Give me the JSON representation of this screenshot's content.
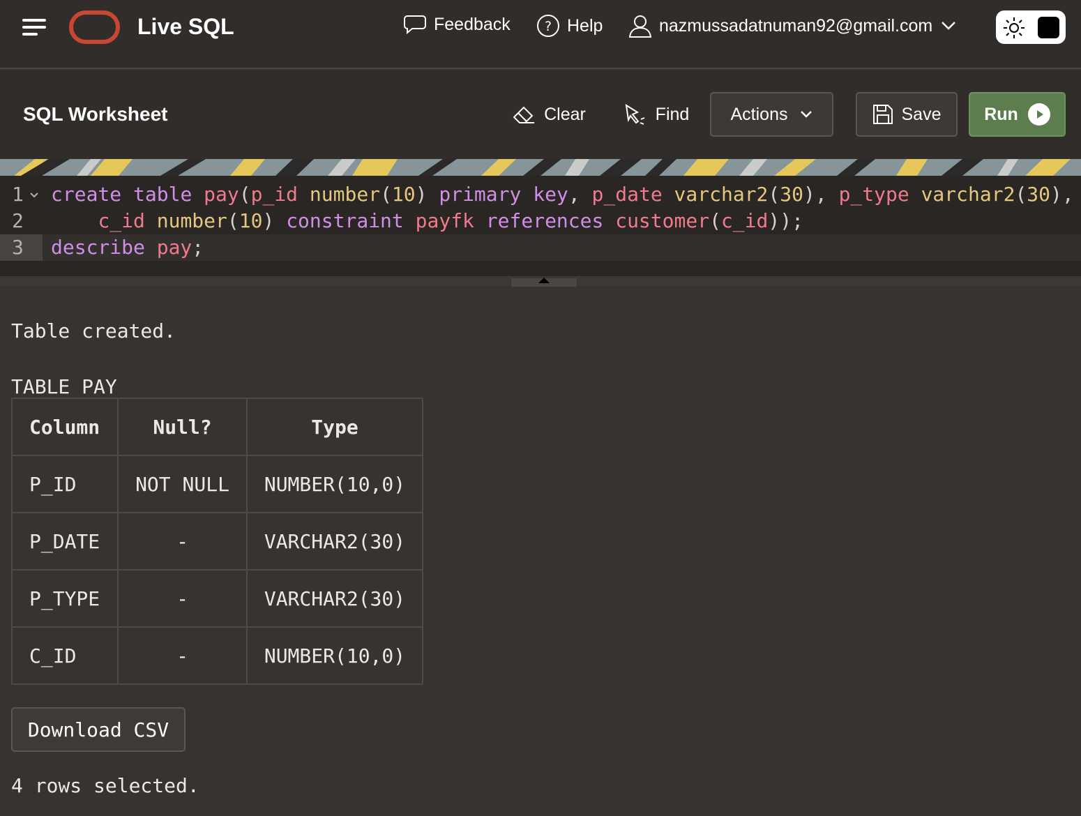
{
  "header": {
    "app_title": "Live SQL",
    "feedback_label": "Feedback",
    "help_label": "Help",
    "user_email": "nazmussadatnuman92@gmail.com",
    "brand_color": "#c74634"
  },
  "toolbar": {
    "title": "SQL Worksheet",
    "clear_label": "Clear",
    "find_label": "Find",
    "actions_label": "Actions",
    "save_label": "Save",
    "run_label": "Run"
  },
  "editor": {
    "line_numbers": [
      "1",
      "2",
      "3"
    ],
    "lines": [
      "create table pay(p_id number(10) primary key, p_date varchar2(30), p_type varchar2(30),",
      "    c_id number(10) constraint payfk references customer(c_id));",
      "describe pay;"
    ]
  },
  "output": {
    "created_message": "Table created.",
    "table_title": "TABLE PAY",
    "columns": [
      "Column",
      "Null?",
      "Type"
    ],
    "rows": [
      [
        "P_ID",
        "NOT NULL",
        "NUMBER(10,0)"
      ],
      [
        "P_DATE",
        "-",
        "VARCHAR2(30)"
      ],
      [
        "P_TYPE",
        "-",
        "VARCHAR2(30)"
      ],
      [
        "C_ID",
        "-",
        "NUMBER(10,0)"
      ]
    ],
    "download_label": "Download CSV",
    "rows_selected": "4 rows selected."
  }
}
